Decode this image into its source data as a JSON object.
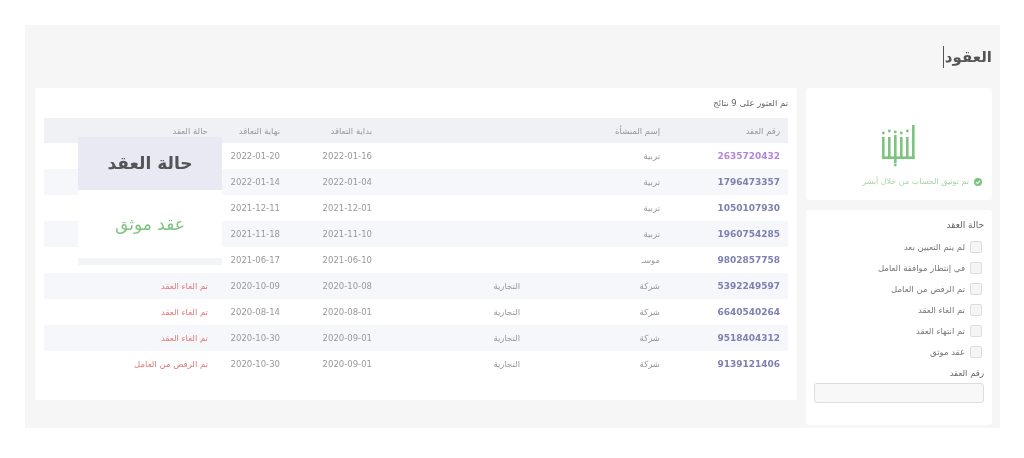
{
  "page_title": "العقود",
  "sidebar": {
    "verification": {
      "text": "تم توثيق الحساب من خلال أبشر"
    },
    "filters": {
      "title": "حالة العقد",
      "options": [
        {
          "label": "لم يتم التعيين بعد",
          "checked": false
        },
        {
          "label": "في إنتظار موافقة العامل",
          "checked": false
        },
        {
          "label": "تم الرفض من العامل",
          "checked": false
        },
        {
          "label": "تم الغاء العقد",
          "checked": false
        },
        {
          "label": "تم انتهاء العقد",
          "checked": false
        },
        {
          "label": "عقد موثق",
          "checked": false
        }
      ],
      "contract_number": {
        "label": "رقم العقد"
      }
    }
  },
  "results": {
    "summary": "تم العثور على 9 نتائج",
    "table": {
      "columns": [
        "رقم العقد",
        "إسم المنشأة",
        "",
        "بداية التعاقد",
        "نهاية التعاقد",
        "حالة العقد"
      ],
      "rows": [
        {
          "contract_number": "2635720432",
          "color": "#b486d8",
          "establishment": "تربية",
          "start": "2022-01-16",
          "end": "2022-01-20"
        },
        {
          "contract_number": "1796473357",
          "color": "#7d80b0",
          "establishment": "تربية",
          "start": "2022-01-04",
          "end": "2022-01-14"
        },
        {
          "contract_number": "1050107930",
          "color": "#7d80b0",
          "establishment": "تربية",
          "start": "2021-12-01",
          "end": "2021-12-11"
        },
        {
          "contract_number": "1960754285",
          "color": "#7d80b0",
          "establishment": "تربية",
          "start": "2021-11-10",
          "end": "2021-11-18"
        },
        {
          "contract_number": "9802857758",
          "color": "#7d80b0",
          "establishment": "موسـ",
          "start": "2021-06-10",
          "end": "2021-06-17"
        },
        {
          "contract_number": "5392249597",
          "color": "#7d80b0",
          "establishment": "شركة",
          "column_3": "التجارية",
          "start": "2020-10-08",
          "end": "2020-10-09",
          "status": "تم الغاء العقد"
        },
        {
          "contract_number": "6640540264",
          "color": "#7d80b0",
          "establishment": "شركة",
          "column_3": "التجارية",
          "start": "2020-08-01",
          "end": "2020-08-14",
          "status": "تم الغاء العقد"
        },
        {
          "contract_number": "9518404312",
          "color": "#7d80b0",
          "establishment": "شركة",
          "column_3": "التجارية",
          "start": "2020-09-01",
          "end": "2020-10-30",
          "status": "تم الغاء العقد"
        },
        {
          "contract_number": "9139121406",
          "color": "#7d80b0",
          "establishment": "شركة",
          "column_3": "التجارية",
          "start": "2020-09-01",
          "end": "2020-10-30",
          "status": "تم الرفض من العامل"
        }
      ]
    },
    "callout": {
      "title": "حالة العقد",
      "value": "عقد موثق"
    }
  }
}
